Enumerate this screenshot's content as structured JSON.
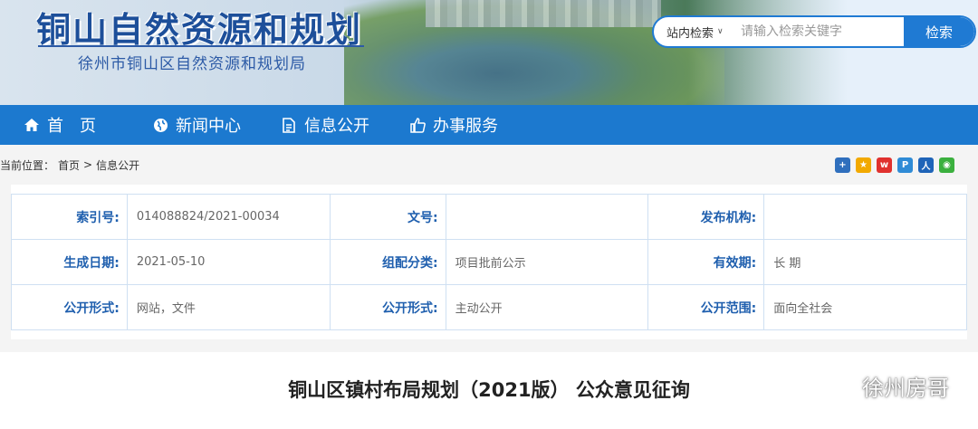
{
  "header": {
    "title": "铜山自然资源和规划",
    "subtitle": "徐州市铜山区自然资源和规划局"
  },
  "search": {
    "scope": "站内检索",
    "placeholder": "请输入检索关键字",
    "button": "检索"
  },
  "nav": [
    {
      "label": "首页",
      "icon": "home-icon"
    },
    {
      "label": "新闻中心",
      "icon": "globe-icon"
    },
    {
      "label": "信息公开",
      "icon": "document-icon"
    },
    {
      "label": "办事服务",
      "icon": "thumbs-up-icon"
    }
  ],
  "breadcrumb": {
    "prefix": "当前位置：",
    "home": "首页",
    "sep": ">",
    "current": "信息公开"
  },
  "shares": [
    {
      "icon": "plus-share-icon",
      "color": "#2f6fbd",
      "glyph": "+"
    },
    {
      "icon": "qzone-share-icon",
      "color": "#f2a900",
      "glyph": "★"
    },
    {
      "icon": "weibo-share-icon",
      "color": "#e0312e",
      "glyph": "w"
    },
    {
      "icon": "tencent-share-icon",
      "color": "#2f8bd6",
      "glyph": "P"
    },
    {
      "icon": "renren-share-icon",
      "color": "#1f64b8",
      "glyph": "人"
    },
    {
      "icon": "wechat-share-icon",
      "color": "#3bb03e",
      "glyph": "◉"
    }
  ],
  "info": {
    "rows": [
      [
        {
          "k": "索引号:",
          "v": "014088824/2021-00034"
        },
        {
          "k": "文号:",
          "v": ""
        },
        {
          "k": "发布机构:",
          "v": ""
        }
      ],
      [
        {
          "k": "生成日期:",
          "v": "2021-05-10"
        },
        {
          "k": "组配分类:",
          "v": "项目批前公示"
        },
        {
          "k": "有效期:",
          "v": "长 期"
        }
      ],
      [
        {
          "k": "公开形式:",
          "v": "网站，文件"
        },
        {
          "k": "公开形式:",
          "v": "主动公开"
        },
        {
          "k": "公开范围:",
          "v": "面向全社会"
        }
      ]
    ]
  },
  "article": {
    "title": "铜山区镇村布局规划（2021版） 公众意见征询"
  },
  "watermark": {
    "text": "徐州房哥"
  }
}
